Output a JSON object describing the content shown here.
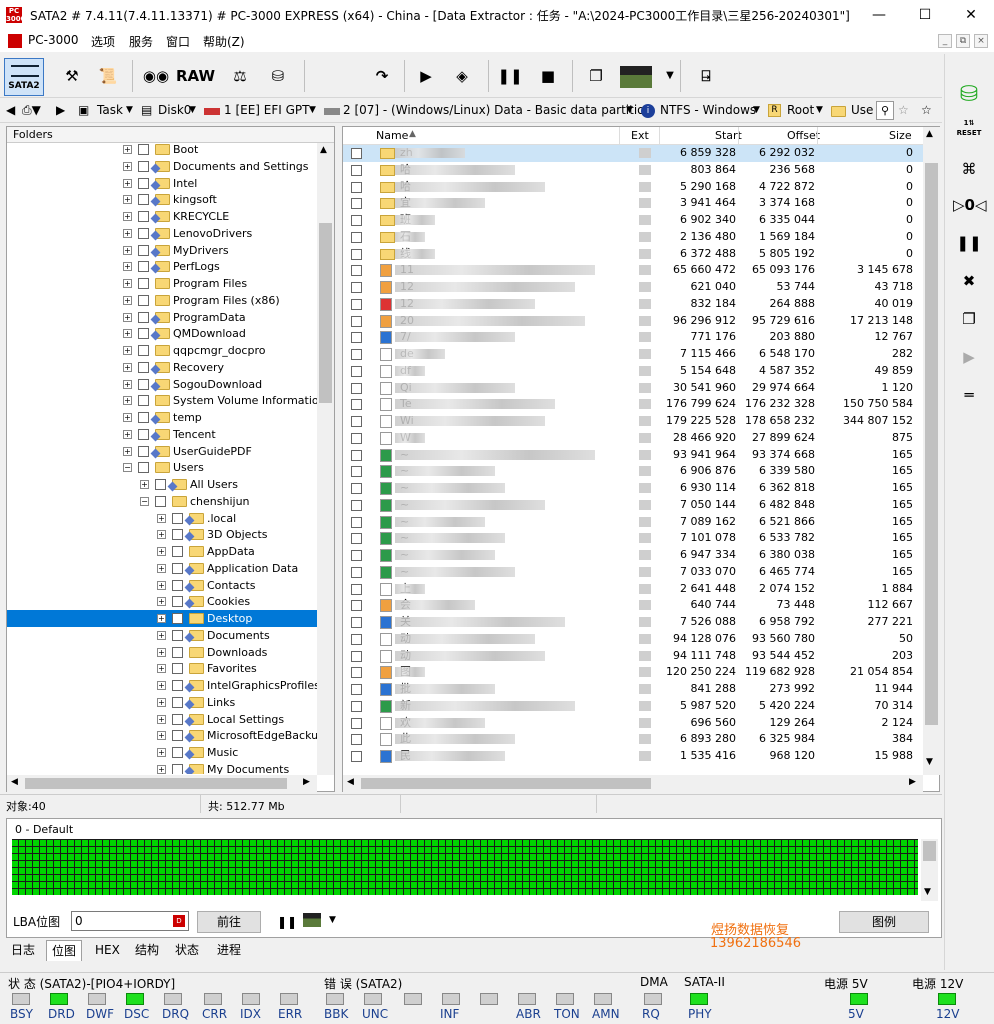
{
  "window": {
    "title": "SATA2 # 7.4.11(7.4.11.13371) # PC-3000 EXPRESS (x64) - China - [Data Extractor : 任务 - \"A:\\2024-PC3000工作目录\\三星256-20240301\"]",
    "icon_text": "PC 3000"
  },
  "menu": {
    "app": "PC-3000",
    "items": [
      "选项",
      "服务",
      "窗口",
      "帮助(Z)"
    ]
  },
  "toolbar": {
    "sata2": "SATA2",
    "raw": "RAW"
  },
  "path": {
    "task": "Task",
    "disk": "Disk0",
    "part1": "1 [EE] EFI GPT",
    "part2": "2 [07] - (Windows/Linux) Data - Basic data partition",
    "fs": "NTFS - Windows",
    "root": "Root",
    "use": "Use"
  },
  "folders": {
    "header": "Folders",
    "items": [
      {
        "label": "Boot",
        "level": 0,
        "shared": false
      },
      {
        "label": "Documents and Settings",
        "level": 0,
        "shared": true
      },
      {
        "label": "Intel",
        "level": 0,
        "shared": true
      },
      {
        "label": "kingsoft",
        "level": 0,
        "shared": true
      },
      {
        "label": "KRECYCLE",
        "level": 0,
        "shared": true
      },
      {
        "label": "LenovoDrivers",
        "level": 0,
        "shared": true
      },
      {
        "label": "MyDrivers",
        "level": 0,
        "shared": true
      },
      {
        "label": "PerfLogs",
        "level": 0,
        "shared": true
      },
      {
        "label": "Program Files",
        "level": 0,
        "shared": false
      },
      {
        "label": "Program Files (x86)",
        "level": 0,
        "shared": false
      },
      {
        "label": "ProgramData",
        "level": 0,
        "shared": true
      },
      {
        "label": "QMDownload",
        "level": 0,
        "shared": true
      },
      {
        "label": "qqpcmgr_docpro",
        "level": 0,
        "shared": false
      },
      {
        "label": "Recovery",
        "level": 0,
        "shared": true
      },
      {
        "label": "SogouDownload",
        "level": 0,
        "shared": true
      },
      {
        "label": "System Volume Information",
        "level": 0,
        "shared": false
      },
      {
        "label": "temp",
        "level": 0,
        "shared": true
      },
      {
        "label": "Tencent",
        "level": 0,
        "shared": true
      },
      {
        "label": "UserGuidePDF",
        "level": 0,
        "shared": true
      },
      {
        "label": "Users",
        "level": 0,
        "shared": false,
        "open": true
      },
      {
        "label": "All Users",
        "level": 1,
        "shared": true
      },
      {
        "label": "chenshijun",
        "level": 1,
        "shared": false,
        "open": true
      },
      {
        "label": ".local",
        "level": 2,
        "shared": true
      },
      {
        "label": "3D Objects",
        "level": 2,
        "shared": true
      },
      {
        "label": "AppData",
        "level": 2,
        "shared": false
      },
      {
        "label": "Application Data",
        "level": 2,
        "shared": true
      },
      {
        "label": "Contacts",
        "level": 2,
        "shared": true
      },
      {
        "label": "Cookies",
        "level": 2,
        "shared": true
      },
      {
        "label": "Desktop",
        "level": 2,
        "shared": false,
        "selected": true
      },
      {
        "label": "Documents",
        "level": 2,
        "shared": true
      },
      {
        "label": "Downloads",
        "level": 2,
        "shared": false
      },
      {
        "label": "Favorites",
        "level": 2,
        "shared": false
      },
      {
        "label": "IntelGraphicsProfiles",
        "level": 2,
        "shared": true
      },
      {
        "label": "Links",
        "level": 2,
        "shared": true
      },
      {
        "label": "Local Settings",
        "level": 2,
        "shared": true
      },
      {
        "label": "MicrosoftEdgeBackups",
        "level": 2,
        "shared": true
      },
      {
        "label": "Music",
        "level": 2,
        "shared": true
      },
      {
        "label": "My Documents",
        "level": 2,
        "shared": true
      }
    ]
  },
  "files": {
    "columns": {
      "name": "Name",
      "ext": "Ext",
      "start": "Start",
      "offset": "Offset",
      "size": "Size"
    },
    "rows": [
      {
        "n": "zh",
        "icon": "folder",
        "s": "6 859 328",
        "o": "6 292 032",
        "z": "0",
        "bw": 70
      },
      {
        "n": "哈",
        "icon": "folder",
        "s": "803 864",
        "o": "236 568",
        "z": "0",
        "bw": 120
      },
      {
        "n": "哈",
        "icon": "folder",
        "s": "5 290 168",
        "o": "4 722 872",
        "z": "0",
        "bw": 150
      },
      {
        "n": "宜",
        "icon": "folder",
        "s": "3 941 464",
        "o": "3 374 168",
        "z": "0",
        "bw": 90
      },
      {
        "n": "班",
        "icon": "folder",
        "s": "6 902 340",
        "o": "6 335 044",
        "z": "0",
        "bw": 40
      },
      {
        "n": "石",
        "icon": "folder",
        "s": "2 136 480",
        "o": "1 569 184",
        "z": "0",
        "bw": 30
      },
      {
        "n": "线",
        "icon": "folder",
        "s": "6 372 488",
        "o": "5 805 192",
        "z": "0",
        "bw": 40
      },
      {
        "n": "11",
        "icon": "img",
        "s": "65 660 472",
        "o": "65 093 176",
        "z": "3 145 678",
        "bw": 200
      },
      {
        "n": "12",
        "icon": "img",
        "s": "621 040",
        "o": "53 744",
        "z": "43 718",
        "bw": 180
      },
      {
        "n": "12",
        "icon": "pdf",
        "s": "832 184",
        "o": "264 888",
        "z": "40 019",
        "bw": 140
      },
      {
        "n": "20",
        "icon": "img",
        "s": "96 296 912",
        "o": "95 729 616",
        "z": "17 213 148",
        "bw": 190
      },
      {
        "n": "7/",
        "icon": "word",
        "s": "771 176",
        "o": "203 880",
        "z": "12 767",
        "bw": 120
      },
      {
        "n": "de",
        "icon": "file",
        "s": "7 115 466",
        "o": "6 548 170",
        "z": "282",
        "bw": 50
      },
      {
        "n": "df",
        "icon": "file",
        "s": "5 154 648",
        "o": "4 587 352",
        "z": "49 859",
        "bw": 30
      },
      {
        "n": "Qi",
        "icon": "file",
        "s": "30 541 960",
        "o": "29 974 664",
        "z": "1 120",
        "bw": 120
      },
      {
        "n": "Te",
        "icon": "file",
        "s": "176 799 624",
        "o": "176 232 328",
        "z": "150 750 584",
        "bw": 160
      },
      {
        "n": "Wi",
        "icon": "file",
        "s": "179 225 528",
        "o": "178 658 232",
        "z": "344 807 152",
        "bw": 150
      },
      {
        "n": "W",
        "icon": "file",
        "s": "28 466 920",
        "o": "27 899 624",
        "z": "875",
        "bw": 30
      },
      {
        "n": "~",
        "icon": "xls",
        "s": "93 941 964",
        "o": "93 374 668",
        "z": "165",
        "bw": 200
      },
      {
        "n": "~",
        "icon": "xls",
        "s": "6 906 876",
        "o": "6 339 580",
        "z": "165",
        "bw": 100
      },
      {
        "n": "~",
        "icon": "xls",
        "s": "6 930 114",
        "o": "6 362 818",
        "z": "165",
        "bw": 110
      },
      {
        "n": "~",
        "icon": "xls",
        "s": "7 050 144",
        "o": "6 482 848",
        "z": "165",
        "bw": 150
      },
      {
        "n": "~",
        "icon": "xls",
        "s": "7 089 162",
        "o": "6 521 866",
        "z": "165",
        "bw": 90
      },
      {
        "n": "~",
        "icon": "xls",
        "s": "7 101 078",
        "o": "6 533 782",
        "z": "165",
        "bw": 110
      },
      {
        "n": "~",
        "icon": "xls",
        "s": "6 947 334",
        "o": "6 380 038",
        "z": "165",
        "bw": 100
      },
      {
        "n": "~",
        "icon": "xls",
        "s": "7 033 070",
        "o": "6 465 774",
        "z": "165",
        "bw": 120
      },
      {
        "n": "上",
        "icon": "file",
        "s": "2 641 448",
        "o": "2 074 152",
        "z": "1 884",
        "bw": 30
      },
      {
        "n": "会",
        "icon": "img",
        "s": "640 744",
        "o": "73 448",
        "z": "112 667",
        "bw": 80
      },
      {
        "n": "关",
        "icon": "word",
        "s": "7 526 088",
        "o": "6 958 792",
        "z": "277 221",
        "bw": 170
      },
      {
        "n": "动",
        "icon": "file",
        "s": "94 128 076",
        "o": "93 560 780",
        "z": "50",
        "bw": 140
      },
      {
        "n": "动",
        "icon": "file",
        "s": "94 111 748",
        "o": "93 544 452",
        "z": "203",
        "bw": 150
      },
      {
        "n": "图",
        "icon": "img",
        "s": "120 250 224",
        "o": "119 682 928",
        "z": "21 054 854",
        "bw": 30
      },
      {
        "n": "批",
        "icon": "word",
        "s": "841 288",
        "o": "273 992",
        "z": "11 944",
        "bw": 100
      },
      {
        "n": "新",
        "icon": "xls",
        "s": "5 987 520",
        "o": "5 420 224",
        "z": "70 314",
        "bw": 180
      },
      {
        "n": "欢",
        "icon": "file",
        "s": "696 560",
        "o": "129 264",
        "z": "2 124",
        "bw": 90
      },
      {
        "n": "此",
        "icon": "file",
        "s": "6 893 280",
        "o": "6 325 984",
        "z": "384",
        "bw": 120
      },
      {
        "n": "民",
        "icon": "word",
        "s": "1 535 416",
        "o": "968 120",
        "z": "15 988",
        "bw": 110
      }
    ]
  },
  "status": {
    "objects": "对象:40",
    "total": "共:  512.77 Mb"
  },
  "lba": {
    "title": "0 - Default",
    "label": "LBA位图",
    "value": "0",
    "go": "前往",
    "legend": "图例"
  },
  "tabs": [
    "日志",
    "位图",
    "HEX",
    "结构",
    "状态",
    "进程"
  ],
  "watermark": {
    "line1": "煜扬数据恢复",
    "line2": "13962186546"
  },
  "bottom": {
    "g1": "状 态 (SATA2)-[PIO4+IORDY]",
    "g2": "错 误 (SATA2)",
    "g3": "DMA",
    "g4": "SATA-II",
    "g5": "电源 5V",
    "g6": "电源 12V",
    "leds": [
      {
        "l": "BSY",
        "on": false
      },
      {
        "l": "DRD",
        "on": true
      },
      {
        "l": "DWF",
        "on": false
      },
      {
        "l": "DSC",
        "on": true
      },
      {
        "l": "DRQ",
        "on": false
      },
      {
        "l": "CRR",
        "on": false
      },
      {
        "l": "IDX",
        "on": false
      },
      {
        "l": "ERR",
        "on": false
      },
      {
        "l": "BBK",
        "on": false
      },
      {
        "l": "UNC",
        "on": false
      },
      {
        "l": "",
        "on": false
      },
      {
        "l": "INF",
        "on": false
      },
      {
        "l": "",
        "on": false
      },
      {
        "l": "ABR",
        "on": false
      },
      {
        "l": "TON",
        "on": false
      },
      {
        "l": "AMN",
        "on": false
      },
      {
        "l": "RQ",
        "on": false
      },
      {
        "l": "PHY",
        "on": true
      },
      {
        "l": "5V",
        "on": true
      },
      {
        "l": "12V",
        "on": true
      }
    ]
  },
  "colors": {
    "selection": "#0078d7",
    "led_on": "#1ee01e",
    "grid": "#00d400",
    "watermark": "#f07010"
  }
}
